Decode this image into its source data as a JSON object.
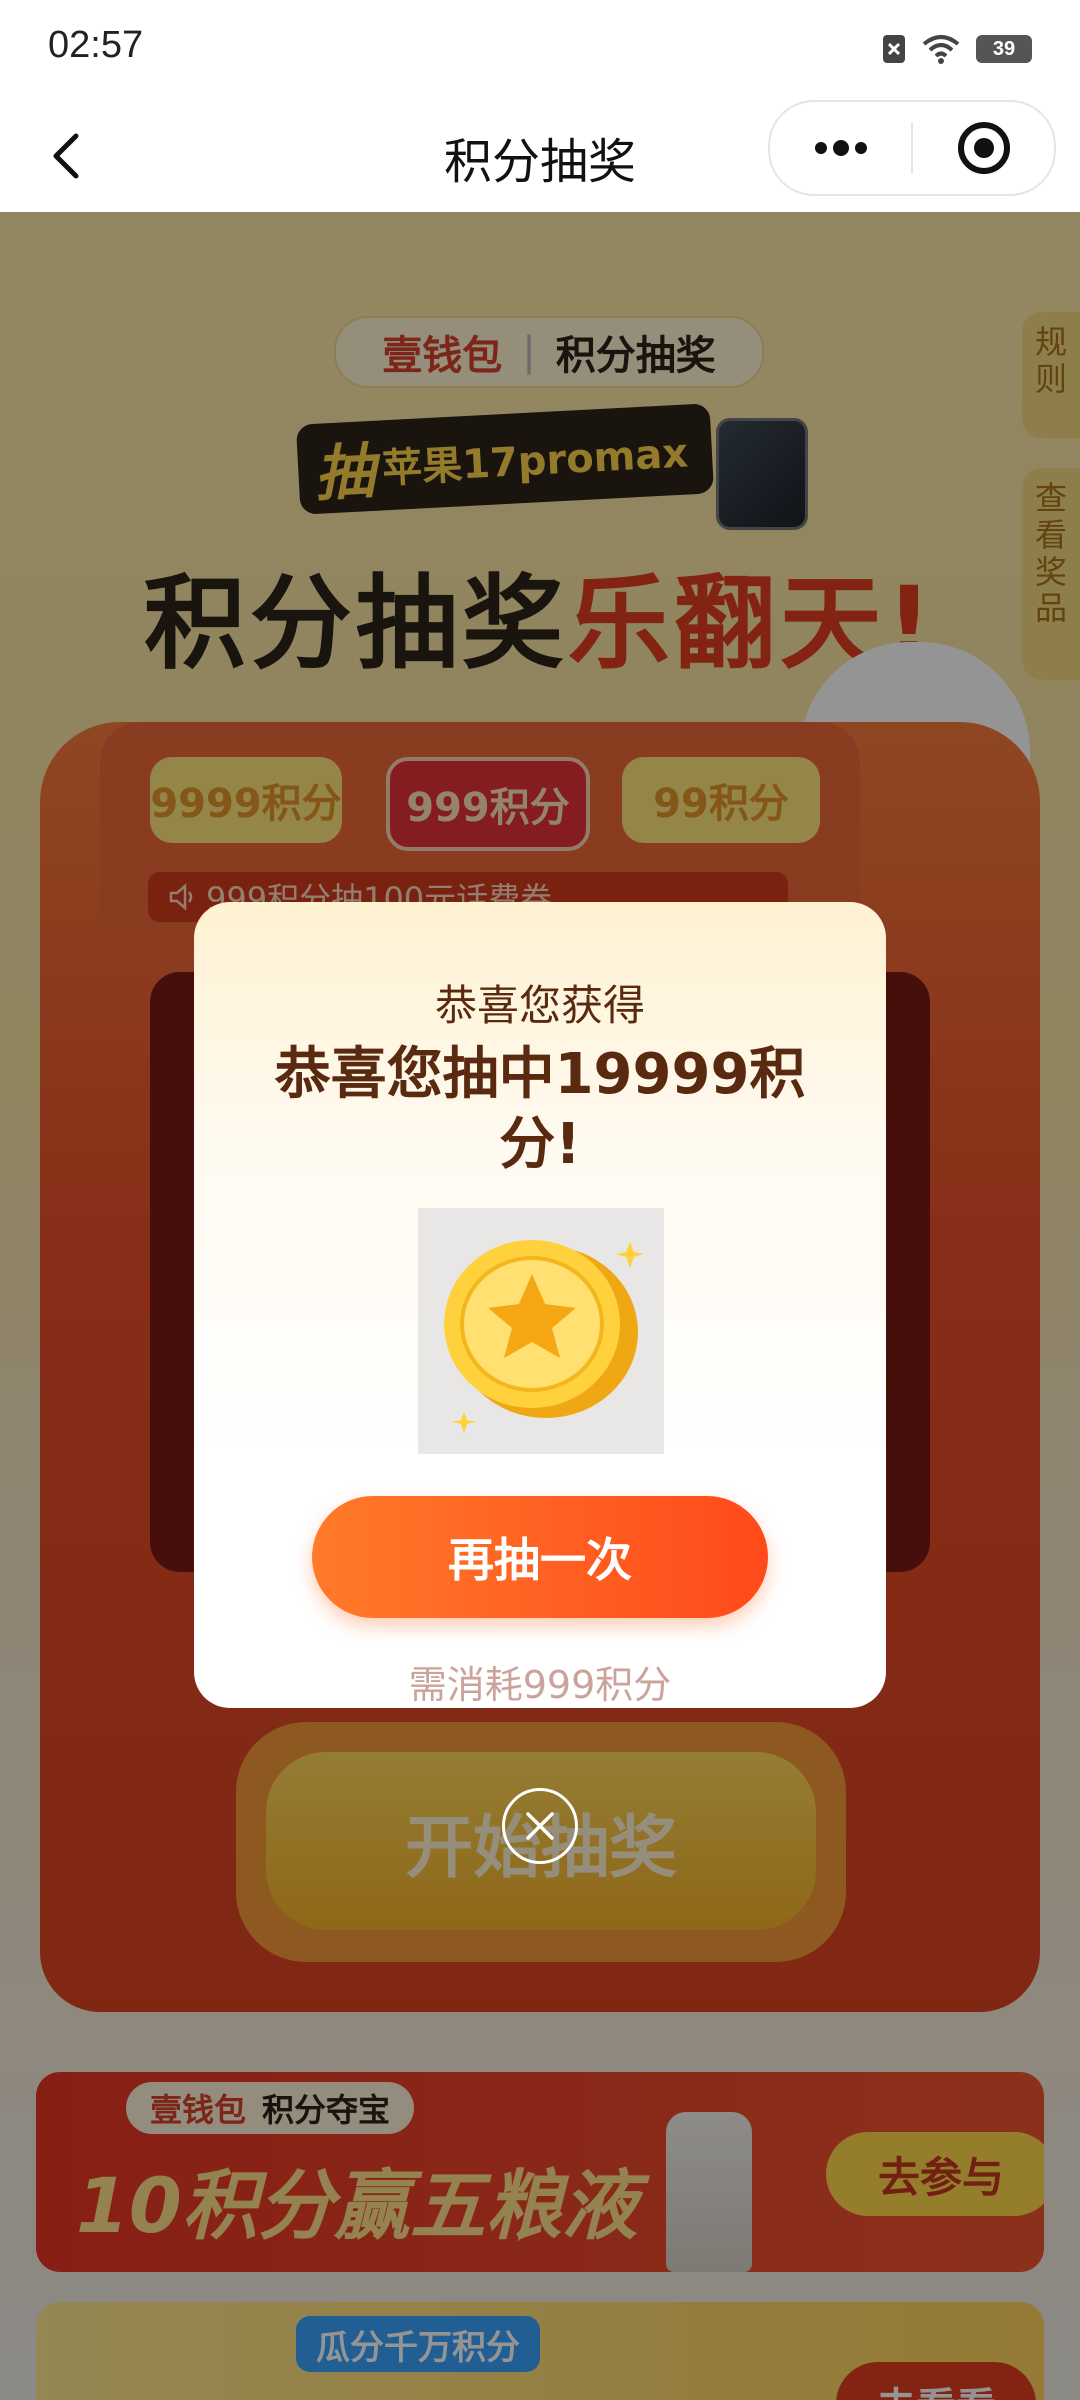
{
  "status_bar": {
    "time": "02:57",
    "battery": "39"
  },
  "nav": {
    "title": "积分抽奖"
  },
  "hero": {
    "brand_left": "壹钱包",
    "brand_right": "积分抽奖",
    "promo_chou": "抽",
    "promo_text": "苹果17promax",
    "headline_dark": "积分抽奖",
    "headline_red": "乐翻天!"
  },
  "side_tabs": {
    "rules": "规则",
    "prizes": "查看奖品"
  },
  "machine": {
    "tiers": [
      "9999积分",
      "999积分",
      "99积分"
    ],
    "notice": "999积分抽100元话费券",
    "start_label": "开始抽奖"
  },
  "banner1": {
    "brand_left": "壹钱包",
    "brand_right": "积分夺宝",
    "title": "10积分赢五粮液",
    "button": "去参与"
  },
  "banner2": {
    "tag": "瓜分千万积分",
    "button": "去看看"
  },
  "dialog": {
    "subtitle": "恭喜您获得",
    "title": "恭喜您抽中19999积分!",
    "again_button": "再抽一次",
    "cost_note": "需消耗999积分"
  },
  "colors": {
    "accent": "#ff5a1f",
    "dialog_text": "#5a2a10",
    "gold": "#ffd54a"
  }
}
